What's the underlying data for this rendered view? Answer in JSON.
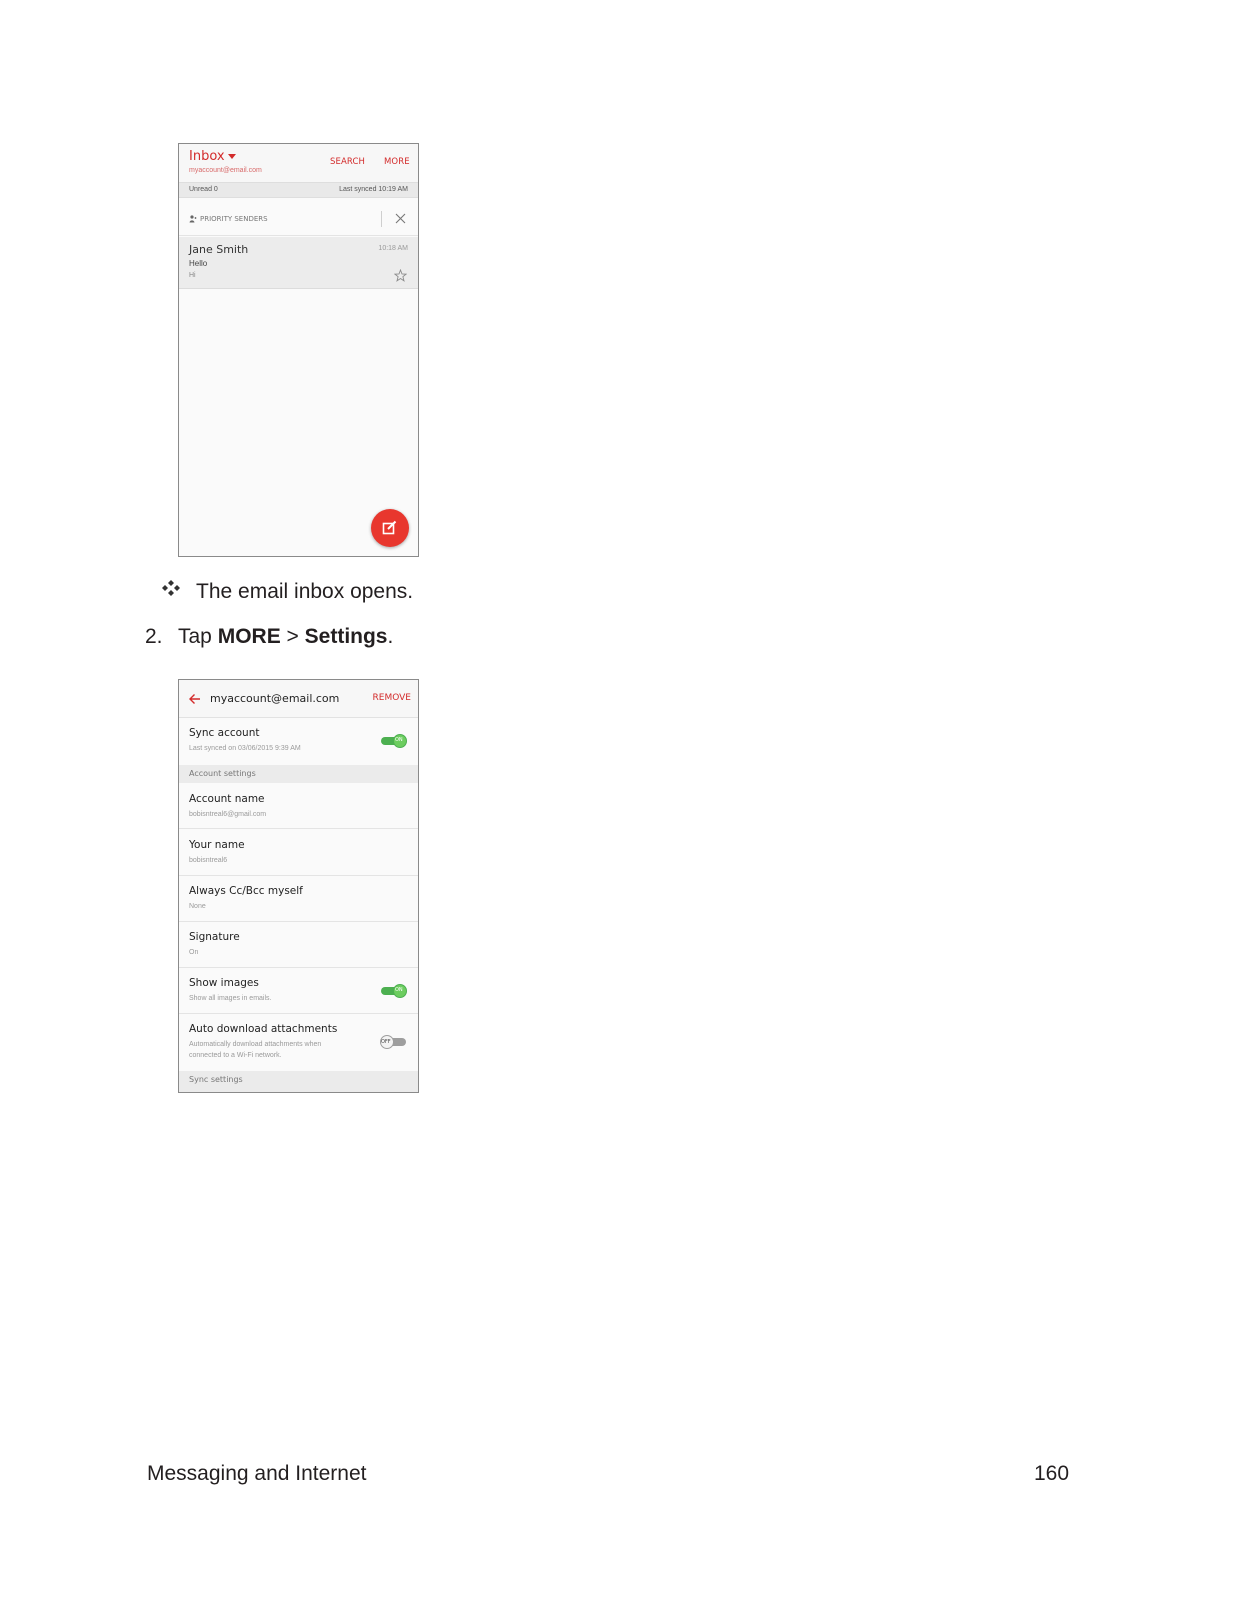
{
  "inbox_screen": {
    "title": "Inbox",
    "account": "myaccount@email.com",
    "search_label": "SEARCH",
    "more_label": "MORE",
    "unread": "Unread 0",
    "last_synced": "Last synced  10:19 AM",
    "priority_label": "PRIORITY SENDERS",
    "email": {
      "sender": "Jane Smith",
      "time": "10:18 AM",
      "subject": "Hello",
      "preview": "Hi"
    },
    "fab_icon": "compose-icon",
    "accent_color": "#d32b2b"
  },
  "bullet": {
    "icon": "diamond-bullet-icon",
    "text": "The email inbox opens."
  },
  "step": {
    "number": "2.",
    "prefix": "Tap ",
    "more": "MORE",
    "separator": " > ",
    "settings": "Settings",
    "suffix": "."
  },
  "settings_screen": {
    "title": "myaccount@email.com",
    "remove_label": "REMOVE",
    "sync_account": {
      "title": "Sync account",
      "sub": "Last synced on 03/06/2015 9:39 AM",
      "toggle": "ON"
    },
    "account_settings_label": "Account settings",
    "account_name": {
      "title": "Account name",
      "sub": "bobisntreal6@gmail.com"
    },
    "your_name": {
      "title": "Your name",
      "sub": "bobisntreal6"
    },
    "always_cc": {
      "title": "Always Cc/Bcc myself",
      "sub": "None"
    },
    "signature": {
      "title": "Signature",
      "sub": "On"
    },
    "show_images": {
      "title": "Show images",
      "sub": "Show all images in emails.",
      "toggle": "ON"
    },
    "auto_download": {
      "title": "Auto download attachments",
      "sub_line1": "Automatically download attachments when",
      "sub_line2": "connected to a Wi-Fi network.",
      "toggle": "OFF"
    },
    "sync_settings_label": "Sync settings"
  },
  "footer": {
    "section": "Messaging and Internet",
    "page_number": "160"
  }
}
